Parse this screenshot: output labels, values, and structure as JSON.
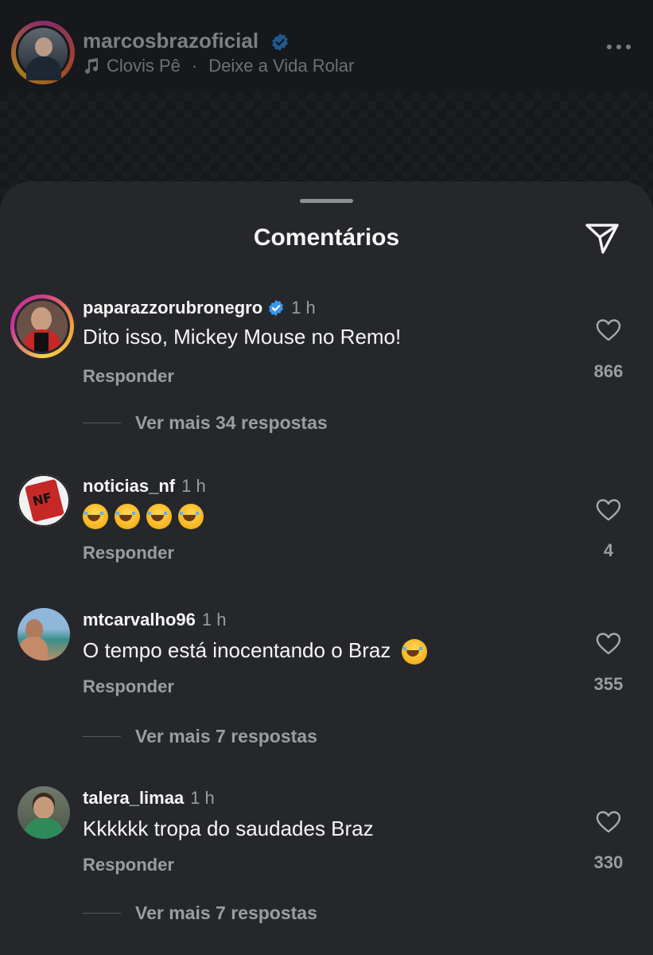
{
  "post": {
    "username": "marcosbrazoficial",
    "music": "Clovis Pê",
    "music_separator": "·",
    "music_title": "Deixe a Vida Rolar"
  },
  "sheet": {
    "title": "Comentários"
  },
  "comments": [
    {
      "username": "paparazzorubronegro",
      "verified": true,
      "time": "1 h",
      "text": "Dito isso, Mickey Mouse no Remo!",
      "reply": "Responder",
      "likes": "866",
      "view_more": "Ver mais 34 respostas"
    },
    {
      "username": "noticias_nf",
      "verified": false,
      "time": "1 h",
      "text": "😂😂😂😂",
      "reply": "Responder",
      "likes": "4"
    },
    {
      "username": "mtcarvalho96",
      "verified": false,
      "time": "1 h",
      "text": "O tempo está inocentando o Braz",
      "text_emoji": "😂",
      "reply": "Responder",
      "likes": "355",
      "view_more": "Ver mais 7 respostas"
    },
    {
      "username": "talera_limaa",
      "verified": false,
      "time": "1 h",
      "text": "Kkkkkk tropa do saudades Braz",
      "reply": "Responder",
      "likes": "330",
      "view_more": "Ver mais 7 respostas"
    }
  ],
  "icons": {
    "verified": "verified-badge-icon",
    "music": "music-note-icon",
    "more": "more-options-icon",
    "share": "send-icon",
    "like": "heart-icon"
  },
  "colors": {
    "sheet_bg": "#25272b",
    "verified_blue": "#3897f0",
    "secondary_text": "#9a9da2"
  }
}
